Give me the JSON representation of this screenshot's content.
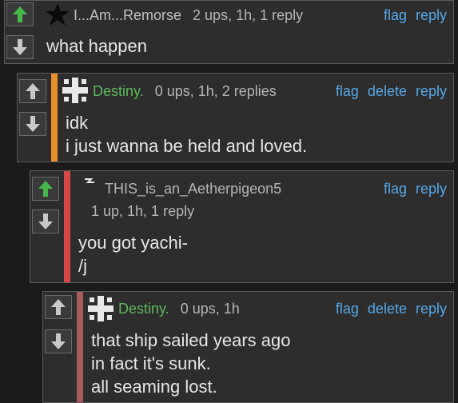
{
  "comments": [
    {
      "author": "I...Am...Remorse",
      "meta": "2 ups, 1h, 1 reply",
      "actions": [
        "flag",
        "reply"
      ],
      "lines": [
        "what happen"
      ],
      "upvoted": true,
      "accent": null
    },
    {
      "author": "Destiny.",
      "meta": "0 ups, 1h, 2 replies",
      "actions": [
        "flag",
        "delete",
        "reply"
      ],
      "lines": [
        "idk",
        "i just wanna be held and loved."
      ],
      "upvoted": false,
      "accent": "#e8902a"
    },
    {
      "author": "THIS_is_an_Aetherpigeon5",
      "meta": "1 up, 1h, 1 reply",
      "actions": [
        "flag",
        "reply"
      ],
      "lines": [
        "you got yachi-",
        "/j"
      ],
      "upvoted": true,
      "accent": "#d94848"
    },
    {
      "author": "Destiny.",
      "meta": "0 ups, 1h",
      "actions": [
        "flag",
        "delete",
        "reply"
      ],
      "lines": [
        "that ship sailed years ago",
        "in fact it's sunk.",
        "all seaming lost."
      ],
      "upvoted": false,
      "accent": "#a85b5b"
    }
  ],
  "colors": {
    "upvote_active": "#46b84b",
    "vote_inactive": "#c8c8c8",
    "link": "#56a7e8",
    "username_green": "#5cb85c"
  }
}
